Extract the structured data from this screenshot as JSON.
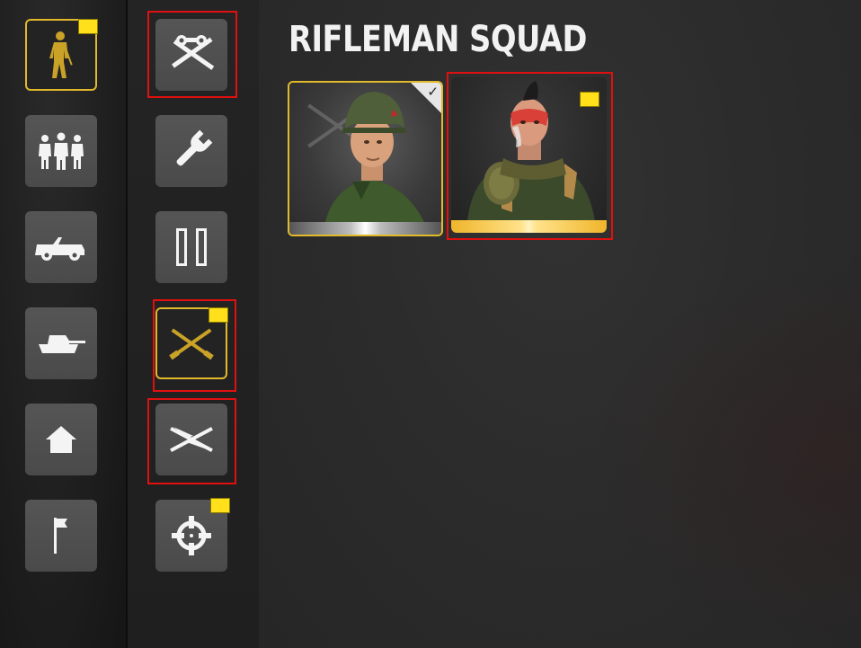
{
  "title": "RIFLEMAN SQUAD",
  "categories": [
    {
      "name": "infantry",
      "icon": "infantry-soldier-icon",
      "active": true,
      "new": true
    },
    {
      "name": "squads",
      "icon": "squad-group-icon",
      "active": false,
      "new": false
    },
    {
      "name": "vehicles",
      "icon": "jeep-icon",
      "active": false,
      "new": false
    },
    {
      "name": "tanks",
      "icon": "tank-icon",
      "active": false,
      "new": false
    },
    {
      "name": "buildings",
      "icon": "house-icon",
      "active": false,
      "new": false
    },
    {
      "name": "objectives",
      "icon": "flag-icon",
      "active": false,
      "new": false
    }
  ],
  "subcategories": [
    {
      "name": "recon",
      "icon": "binoculars-crossed-rifles-icon",
      "new": false,
      "highlighted": true
    },
    {
      "name": "engineer",
      "icon": "wrench-icon",
      "new": false,
      "highlighted": false
    },
    {
      "name": "command",
      "icon": "captain-bars-icon",
      "new": false,
      "highlighted": false
    },
    {
      "name": "rifleman",
      "icon": "crossed-rifles-icon",
      "new": true,
      "active": true,
      "highlighted": true
    },
    {
      "name": "heavy-weapons",
      "icon": "lightning-crossed-rifles-icon",
      "new": false,
      "highlighted": true
    },
    {
      "name": "sniper",
      "icon": "crosshair-icon",
      "new": true,
      "highlighted": false
    }
  ],
  "cards": [
    {
      "name": "default-rifleman-skin",
      "portrait": "helmeted-soldier-portrait",
      "equipped": true,
      "new": false,
      "rarity_color": "#c8c8c8"
    },
    {
      "name": "warpaint-rifleman-skin",
      "portrait": "mohawk-warpaint-soldier-portrait",
      "equipped": false,
      "new": true,
      "rarity_color": "#f0b52a",
      "highlighted": true
    }
  ],
  "colors": {
    "accent": "#e2b92b",
    "new_flag": "#ffe01a",
    "highlight": "#e01010"
  }
}
